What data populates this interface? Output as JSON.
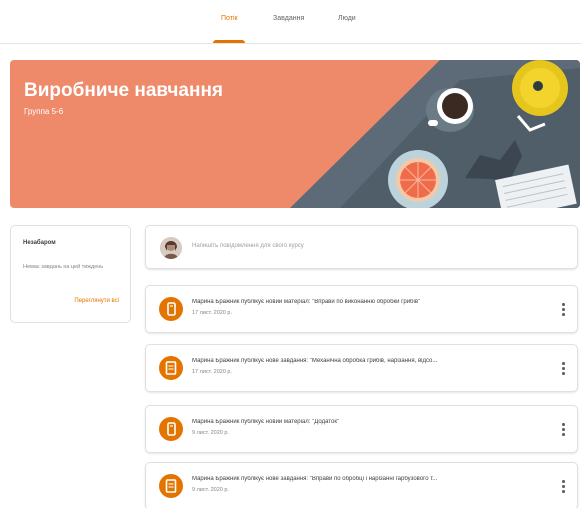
{
  "tabs": [
    "Потік",
    "Завдання",
    "Люди"
  ],
  "banner": {
    "title": "Виробниче навчання",
    "subtitle": "Группа 5-6"
  },
  "upcoming": {
    "title": "Незабаром",
    "text": "Немає завдань на цей тиждень",
    "link": "Переглянути всі"
  },
  "announce": {
    "placeholder": "Напишіть повідомлення для свого курсу"
  },
  "feed": [
    {
      "title": "Марина Бражник публікує новий матеріал: \"Вправи по виконанню обробки грибів\"",
      "date": "17 лист. 2020 р.",
      "icon": "material-icon"
    },
    {
      "title": "Марина Бражник публікує нове завдання: \"Механічна обробка грибів, нарізання, відсо...",
      "date": "17 лист. 2020 р.",
      "icon": "assignment-icon"
    },
    {
      "title": "Марина Бражник публікує новий матеріал: \"Додаток\"",
      "date": "9 лист. 2020 р.",
      "icon": "material-icon"
    },
    {
      "title": "Марина Бражник публікує нове завдання: \"Вправи по обробці і нарізанні гарбузового т...",
      "date": "9 лист. 2020 р.",
      "icon": "assignment-icon"
    }
  ],
  "colors": {
    "accent": "#e37400",
    "banner": "#ee8a6a",
    "banner_dark": "#5f6f7a"
  }
}
